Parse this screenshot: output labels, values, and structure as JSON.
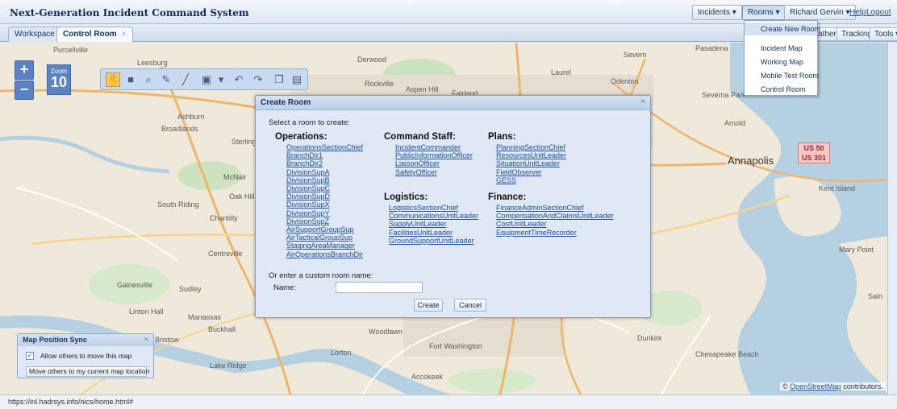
{
  "header": {
    "app_title": "Next-Generation Incident Command System",
    "incidents_label": "Incidents ▾",
    "rooms_label": "Rooms ▾",
    "user_label": "Richard Gervin ▾",
    "help_label": "Help",
    "logout_label": "Logout"
  },
  "tabs": [
    {
      "label": "Workspace"
    },
    {
      "label": "Control Room",
      "close": "×"
    }
  ],
  "right_tabs": {
    "weather": "ather",
    "tracking": "Tracking",
    "tools": "Tools ▾"
  },
  "rooms_menu": [
    "Create New Room",
    "Incident Map",
    "Working Map",
    "Mobile Test Room",
    "Control Room"
  ],
  "map": {
    "zoom_label": "Zoom",
    "zoom_level": "10",
    "places": [
      "Purcellville",
      "Leesburg",
      "Derwood",
      "Laurel",
      "Severn",
      "Pasadena",
      "Odenton",
      "Rockville",
      "Aspen Hill",
      "Fairland",
      "Severna Park",
      "Ashburn",
      "Broadlands",
      "Sterling",
      "Arnold",
      "Annapolis",
      "McNair",
      "Oak Hill",
      "South Riding",
      "Chantilly",
      "Centreville",
      "Gainesville",
      "Sudley",
      "Linton Hall",
      "Manassas",
      "Buckhall",
      "Bristow",
      "Woodlawn",
      "Fort Washington",
      "Lorton",
      "Lake Ridge",
      "Accokeek",
      "Dunkirk",
      "Chesapeake Beach",
      "Kent Island",
      "Mary Point",
      "Sain"
    ],
    "highway_shield": [
      "US 50",
      "US 301"
    ],
    "attribution_prefix": "©",
    "attribution_link": "OpenStreetMap",
    "attribution_suffix": "contributors."
  },
  "dialog": {
    "title": "Create Room",
    "close": "×",
    "prompt": "Select a room to create:",
    "groups": [
      {
        "name": "Operations:",
        "rooms": [
          "OperationsSectionChief",
          "BranchDir1",
          "BranchDir2",
          "DivisionSupA",
          "DivisionSupB",
          "DivisionSupC",
          "DivisionSupD",
          "DivisionSupX",
          "DivisionSupY",
          "DivisionSupZ",
          "AirSupportGroupSup",
          "AirTacticalGroupSup",
          "StagingAreaManager",
          "AirOperationsBranchDir"
        ]
      },
      {
        "name": "Command Staff:",
        "rooms": [
          "IncidentCommander",
          "PublicInformationOfficer",
          "LiaisonOfficer",
          "SafetyOfficer"
        ]
      },
      {
        "name": "Logistics:",
        "rooms": [
          "LogisticsSectionChief",
          "CommunicationsUnitLeader",
          "SupplyUnitLeader",
          "FacilitiesUnitLeader",
          "GroundSupportUnitLeader"
        ]
      },
      {
        "name": "Plans:",
        "rooms": [
          "PlanningSectionChief",
          "ResourcesUnitLeader",
          "SituationUnitLeader",
          "FieldObserver",
          "GESS"
        ]
      },
      {
        "name": "Finance:",
        "rooms": [
          "FinanceAdminSectionChief",
          "CompensationAndClaimsUnitLeader",
          "CostUnitLeader",
          "EquipmentTimeRecorder"
        ]
      }
    ],
    "custom_prompt": "Or enter a custom room name:",
    "name_label": "Name:",
    "name_value": "",
    "create_label": "Create",
    "cancel_label": "Cancel"
  },
  "sync_panel": {
    "title": "Map Position Sync",
    "close": "×",
    "checkbox_checked": true,
    "checkbox_mark": "✓",
    "checkbox_label": "Allow others to move this map",
    "button_label": "Move others to my current map location"
  },
  "status_url": "https://inl.hadrsys.info/nics/home.html#"
}
